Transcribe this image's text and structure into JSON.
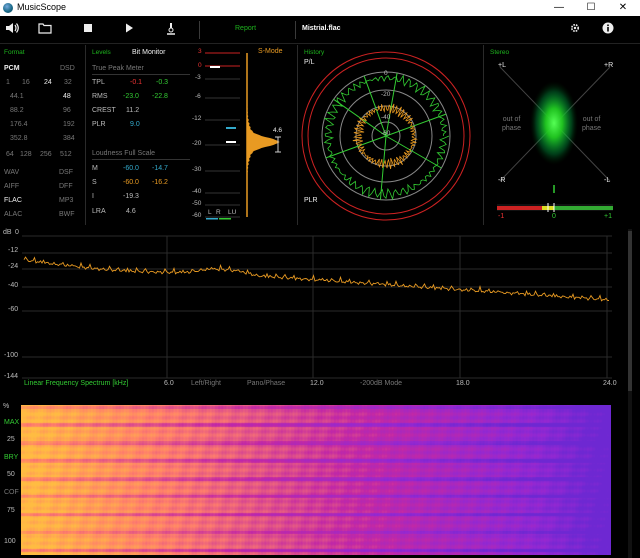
{
  "window": {
    "title": "MusicScope",
    "minimize": "—",
    "maximize": "☐",
    "close": "✕"
  },
  "toolbar": {
    "icons": [
      "volume-icon",
      "folder-icon",
      "stop-icon",
      "play-icon",
      "microscope-icon"
    ],
    "report_label": "Report",
    "file_name": "Mistrial.flac",
    "right_icons": [
      "gear-icon",
      "info-icon"
    ]
  },
  "format": {
    "title": "Format",
    "pcm": "PCM",
    "dsd": "DSD",
    "bits": [
      "1",
      "16",
      "24",
      "32"
    ],
    "bits_active": "24",
    "rates": [
      [
        "44.1",
        "48"
      ],
      [
        "88.2",
        "96"
      ],
      [
        "176.4",
        "192"
      ],
      [
        "352.8",
        "384"
      ]
    ],
    "rates_active": "48",
    "dsd_rates": [
      "64",
      "128",
      "256",
      "512"
    ],
    "formats": [
      [
        "WAV",
        "DSF"
      ],
      [
        "AIFF",
        "DFF"
      ],
      [
        "FLAC",
        "MP3"
      ],
      [
        "ALAC",
        "BWF"
      ]
    ],
    "format_active": "FLAC"
  },
  "levels": {
    "title": "Levels",
    "bit_monitor": "Bit Monitor",
    "true_peak_title": "True Peak Meter",
    "rows": [
      {
        "label": "TPL",
        "l": "-0.1",
        "r": "-0.3"
      },
      {
        "label": "RMS",
        "l": "-23.0",
        "r": "-22.8"
      },
      {
        "label": "CREST",
        "v": "11.2"
      },
      {
        "label": "PLR",
        "v": "9.0"
      }
    ],
    "loudness_title": "Loudness Full Scale",
    "loudness": [
      {
        "label": "M",
        "a": "-60.0",
        "b": "-14.7"
      },
      {
        "label": "S",
        "a": "-60.0",
        "b": "-16.2"
      },
      {
        "label": "I",
        "v": "-19.3"
      },
      {
        "label": "LRA",
        "v": "4.6"
      }
    ]
  },
  "meter": {
    "smode": "S-Mode",
    "ticks": [
      "3",
      "0",
      "-3",
      "-6",
      "-12",
      "-20",
      "-30",
      "-40",
      "-50",
      "-60"
    ],
    "legend": [
      "L",
      "R",
      "LU"
    ],
    "value": "4.6"
  },
  "history": {
    "title": "History",
    "pl": "P/L",
    "plr": "PLR",
    "rings": [
      "0",
      "-20",
      "-40",
      "-60"
    ]
  },
  "stereo": {
    "title": "Stereo",
    "corners": [
      "+L",
      "+R",
      "-R",
      "-L"
    ],
    "oop_left": "out of\nphase",
    "oop_right": "out of\nphase",
    "scale": [
      "-1",
      "0",
      "+1"
    ]
  },
  "spectrum": {
    "y_unit": "dB",
    "y_ticks": [
      "0",
      "-12",
      "-24",
      "-40",
      "-60",
      "-100",
      "-144"
    ],
    "x_ticks": [
      "6.0",
      "12.0",
      "18.0",
      "24.0"
    ],
    "labels": [
      "Linear Frequency Spectrum [kHz]",
      "Left/Right",
      "Pano/Phase",
      "-200dB Mode"
    ]
  },
  "spectrogram": {
    "y_unit": "%",
    "labels": [
      "MAX",
      "25",
      "BRY",
      "50",
      "COF",
      "75",
      "100"
    ]
  }
}
